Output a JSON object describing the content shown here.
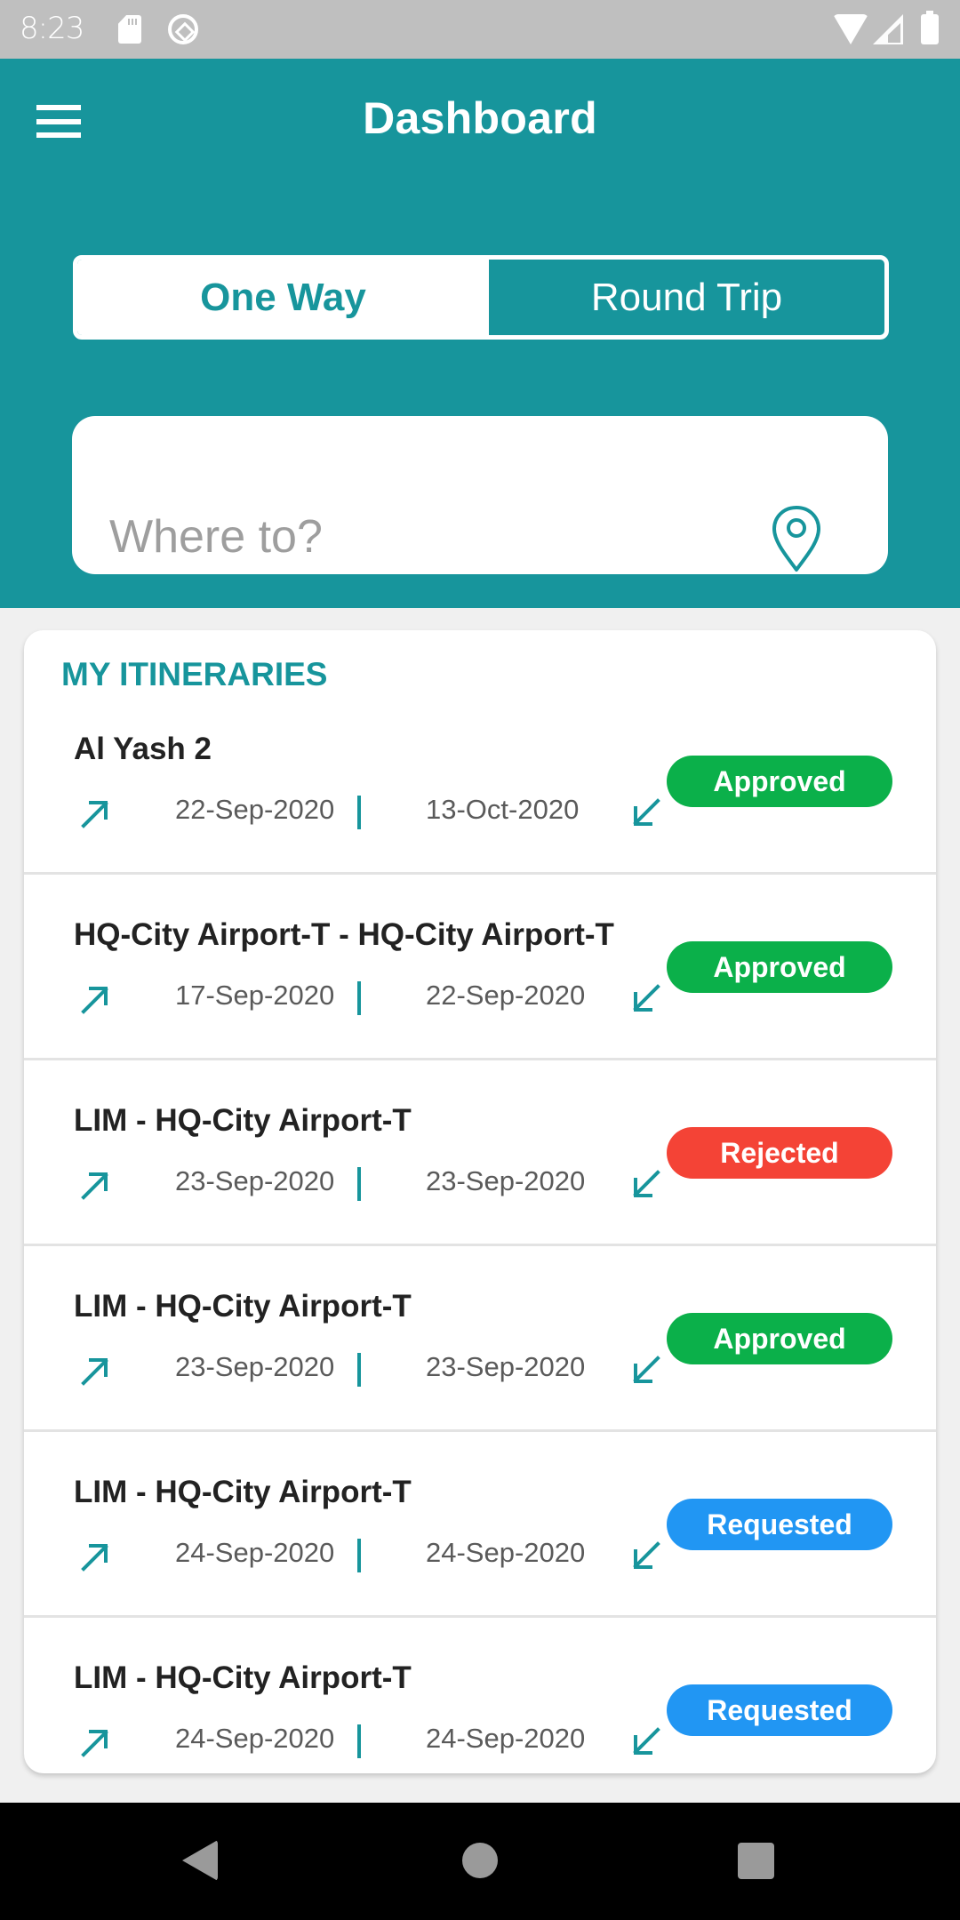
{
  "status_bar": {
    "time": "8:23",
    "icons": [
      "sd-card-icon",
      "sync-icon",
      "wifi-icon",
      "signal-icon",
      "battery-icon"
    ]
  },
  "header": {
    "title": "Dashboard",
    "menu_icon": "hamburger-menu-icon"
  },
  "trip_toggle": {
    "options": [
      {
        "label": "One Way",
        "selected": true
      },
      {
        "label": "Round Trip",
        "selected": false
      }
    ]
  },
  "search": {
    "placeholder": "Where to?",
    "value": "",
    "icon": "location-pin-icon"
  },
  "itineraries": {
    "title": "MY ITINERARIES",
    "items": [
      {
        "name": "Al Yash 2",
        "departure": "22-Sep-2020",
        "return": "13-Oct-2020",
        "status": "Approved",
        "status_color": "#0bb04a"
      },
      {
        "name": "HQ-City Airport-T - HQ-City Airport-T",
        "departure": "17-Sep-2020",
        "return": "22-Sep-2020",
        "status": "Approved",
        "status_color": "#0bb04a"
      },
      {
        "name": "LIM - HQ-City Airport-T",
        "departure": "23-Sep-2020",
        "return": "23-Sep-2020",
        "status": "Rejected",
        "status_color": "#f44336"
      },
      {
        "name": "LIM - HQ-City Airport-T",
        "departure": "23-Sep-2020",
        "return": "23-Sep-2020",
        "status": "Approved",
        "status_color": "#0bb04a"
      },
      {
        "name": "LIM - HQ-City Airport-T",
        "departure": "24-Sep-2020",
        "return": "24-Sep-2020",
        "status": "Requested",
        "status_color": "#2196f3"
      },
      {
        "name": "LIM - HQ-City Airport-T",
        "departure": "24-Sep-2020",
        "return": "24-Sep-2020",
        "status": "Requested",
        "status_color": "#2196f3"
      }
    ]
  },
  "colors": {
    "primary": "#17959c",
    "background": "#f0f0f0",
    "approved": "#0bb04a",
    "rejected": "#f44336",
    "requested": "#2196f3"
  },
  "nav_bar": {
    "buttons": [
      "back-icon",
      "home-icon",
      "recents-icon"
    ]
  }
}
